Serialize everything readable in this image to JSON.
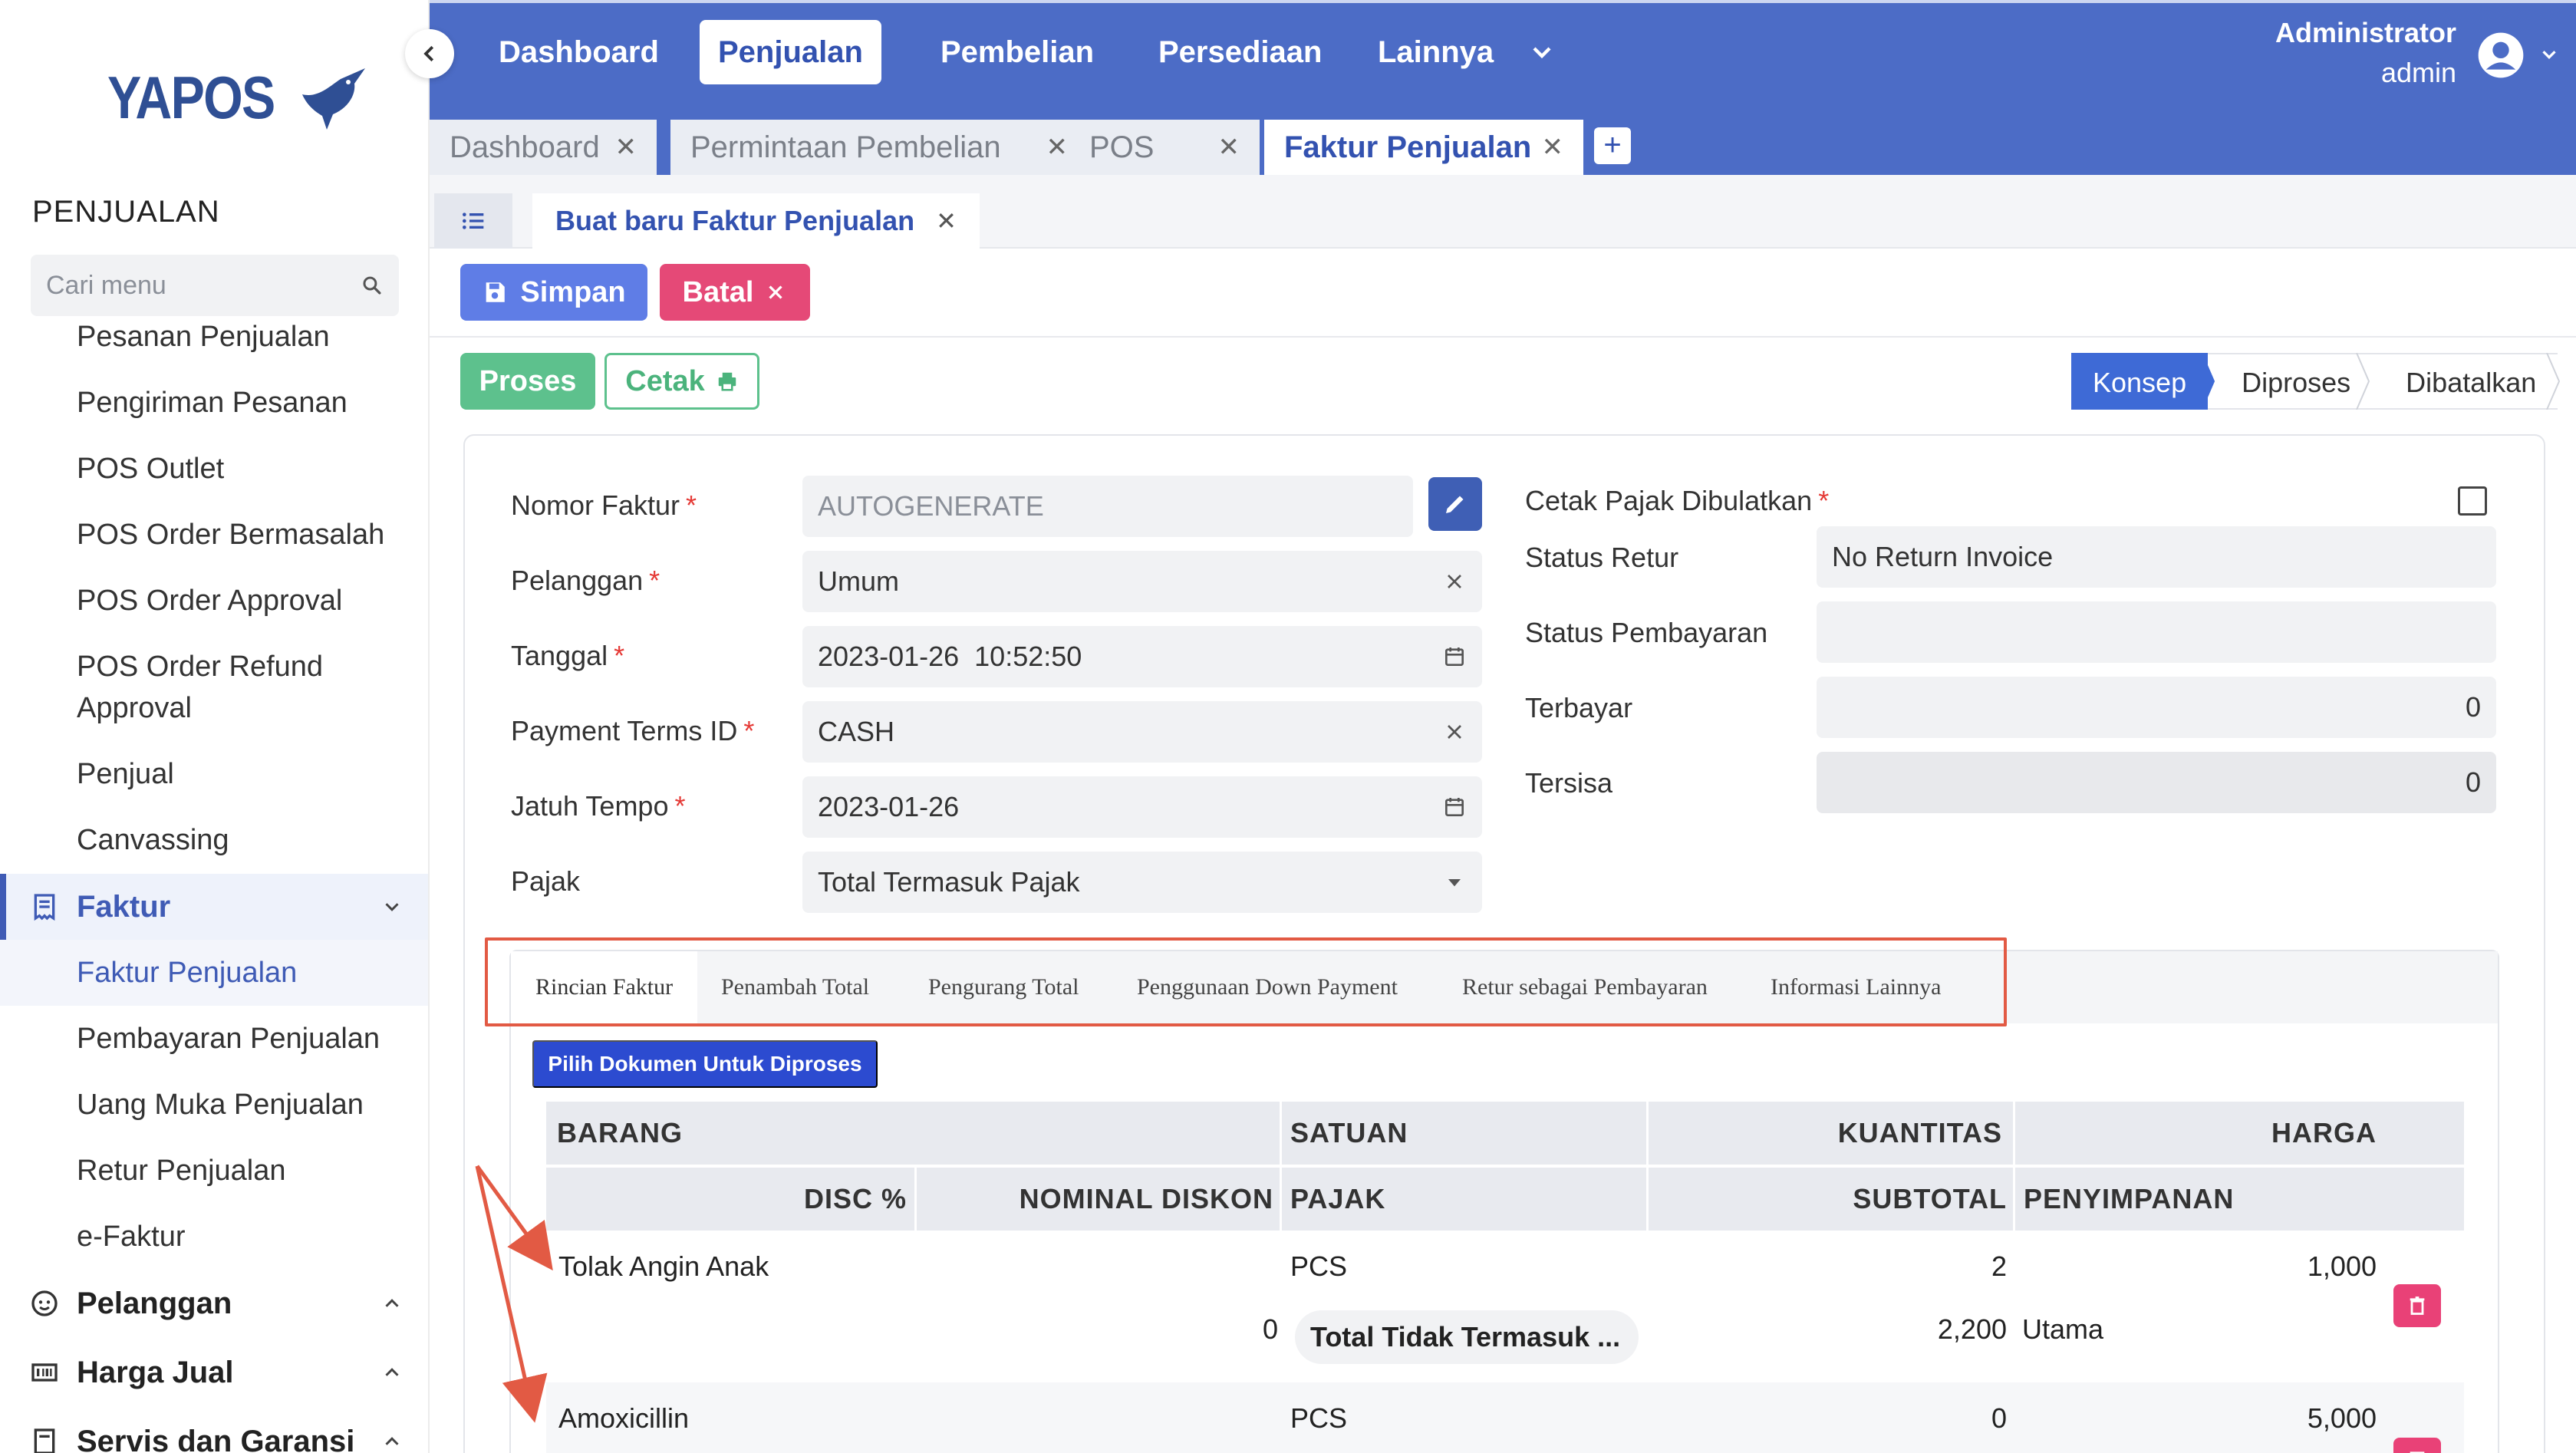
{
  "brand": {
    "logo_text": "YAPOS"
  },
  "sidebar": {
    "section_title": "PENJUALAN",
    "search_placeholder": "Cari menu",
    "items": [
      "Pesanan Penjualan",
      "Pengiriman Pesanan",
      "POS Outlet",
      "POS Order Bermasalah",
      "POS Order Approval",
      "POS Order Refund",
      "Approval",
      "Penjual",
      "Canvassing"
    ],
    "groups": {
      "faktur": "Faktur",
      "pelanggan": "Pelanggan",
      "harga_jual": "Harga Jual",
      "servis": "Servis dan Garansi"
    },
    "faktur_items": [
      "Faktur Penjualan",
      "Pembayaran Penjualan",
      "Uang Muka Penjualan",
      "Retur Penjualan",
      "e-Faktur"
    ]
  },
  "topnav": {
    "items": [
      "Dashboard",
      "Penjualan",
      "Pembelian",
      "Persediaan",
      "Lainnya"
    ],
    "active": "Penjualan",
    "user_name": "Administrator",
    "user_role": "admin"
  },
  "doc_tabs": [
    {
      "label": "Dashboard"
    },
    {
      "label": "Permintaan Pembelian"
    },
    {
      "label": "POS"
    },
    {
      "label": "Faktur Penjualan"
    }
  ],
  "sub_tab": {
    "label": "Buat baru Faktur Penjualan"
  },
  "toolbar": {
    "save": "Simpan",
    "cancel": "Batal",
    "process": "Proses",
    "print": "Cetak"
  },
  "status_steps": [
    "Konsep",
    "Diproses",
    "Dibatalkan"
  ],
  "form": {
    "nomor_faktur": {
      "label": "Nomor Faktur",
      "placeholder": "AUTOGENERATE"
    },
    "pelanggan": {
      "label": "Pelanggan",
      "value": "Umum"
    },
    "tanggal": {
      "label": "Tanggal",
      "value": "2023-01-26  10:52:50"
    },
    "payment_terms": {
      "label": "Payment Terms ID",
      "value": "CASH"
    },
    "jatuh_tempo": {
      "label": "Jatuh Tempo",
      "value": "2023-01-26"
    },
    "pajak": {
      "label": "Pajak",
      "value": "Total Termasuk Pajak"
    },
    "cetak_pajak": {
      "label": "Cetak Pajak Dibulatkan"
    },
    "status_retur": {
      "label": "Status Retur",
      "value": "No Return Invoice"
    },
    "status_pembayaran": {
      "label": "Status Pembayaran",
      "value": ""
    },
    "terbayar": {
      "label": "Terbayar",
      "value": "0"
    },
    "tersisa": {
      "label": "Tersisa",
      "value": "0"
    }
  },
  "detail_tabs": [
    "Rincian Faktur",
    "Penambah Total",
    "Pengurang Total",
    "Penggunaan Down Payment",
    "Retur sebagai Pembayaran",
    "Informasi Lainnya"
  ],
  "pick_button": "Pilih Dokumen Untuk Diproses",
  "table": {
    "headers_row1": {
      "barang": "BARANG",
      "satuan": "SATUAN",
      "kuantitas": "KUANTITAS",
      "harga": "HARGA"
    },
    "headers_row2": {
      "disc": "DISC %",
      "nominal": "NOMINAL DISKON",
      "pajak": "PAJAK",
      "subtotal": "SUBTOTAL",
      "penyimpanan": "PENYIMPANAN"
    },
    "rows": [
      {
        "barang": "Tolak Angin Anak",
        "satuan": "PCS",
        "kuantitas": "2",
        "harga": "1,000",
        "disc": "0",
        "pajak": "Total Tidak Termasuk ...",
        "subtotal": "2,200",
        "penyimpanan": "Utama"
      },
      {
        "barang": "Amoxicillin",
        "satuan": "PCS",
        "kuantitas": "0",
        "harga": "5,000"
      }
    ]
  },
  "colors": {
    "primary": "#4c6cc6",
    "accent_blue": "#3352b0",
    "save": "#5f7de6",
    "cancel": "#e54977",
    "process": "#5dc18d",
    "annotation": "#e25a44"
  }
}
